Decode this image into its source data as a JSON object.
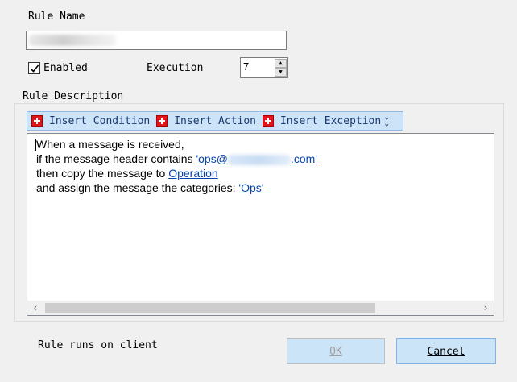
{
  "rule_name": {
    "label": "Rule Name",
    "value": ""
  },
  "enabled": {
    "label": "Enabled",
    "checked": true
  },
  "execution": {
    "label": "Execution",
    "value": "7"
  },
  "description": {
    "title": "Rule Description",
    "toolbar": {
      "insert_condition": "Insert Condition",
      "insert_action": "Insert Action",
      "insert_exception": "Insert Exception"
    },
    "lines": {
      "l1": "When a message is received,",
      "l2_prefix": "if the message header contains ",
      "l2_link_start": "'ops@",
      "l2_link_end": ".com'",
      "l3_prefix": "then copy the message to ",
      "l3_link": "Operation",
      "l4_prefix": "and assign the message the categories: ",
      "l4_link": "'Ops'"
    }
  },
  "footer": {
    "status": "Rule runs on client",
    "ok_label": "OK",
    "cancel_label": "Cancel"
  },
  "colors": {
    "toolbar_bg": "#cde3f7",
    "plus_red": "#e0161b",
    "link": "#0645ad"
  }
}
